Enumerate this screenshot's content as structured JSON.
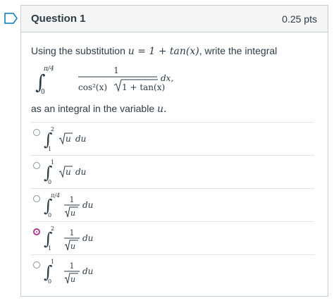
{
  "question": {
    "title": "Question 1",
    "points": "0.25 pts",
    "prompt_prefix": "Using the substitution ",
    "substitution": "u = 1 + tan(x)",
    "prompt_suffix": ", write the integral",
    "integral": {
      "lower": "0",
      "upper": "π/4",
      "numerator": "1",
      "denominator_left": "cos²(x)",
      "denominator_radicand": "1 + tan(x)",
      "differential": "dx,"
    },
    "after_prefix": "as an integral in the variable ",
    "variable": "u."
  },
  "answers": [
    {
      "lower": "1",
      "upper": "2",
      "form": "sqrt",
      "integrand": "u",
      "differential": "du",
      "selected": false
    },
    {
      "lower": "0",
      "upper": "1",
      "form": "sqrt",
      "integrand": "u",
      "differential": "du",
      "selected": false
    },
    {
      "lower": "0",
      "upper": "π/4",
      "form": "frac",
      "numerator": "1",
      "integrand": "u",
      "differential": "du",
      "selected": false
    },
    {
      "lower": "1",
      "upper": "2",
      "form": "frac",
      "numerator": "1",
      "integrand": "u",
      "differential": "du",
      "selected": true
    },
    {
      "lower": "0",
      "upper": "1",
      "form": "frac",
      "numerator": "1",
      "integrand": "u",
      "differential": "du",
      "selected": false
    }
  ],
  "colors": {
    "accent": "#b0388f",
    "flag": "#0374b5",
    "border": "#c7cdd1",
    "text": "#2d3b45"
  }
}
